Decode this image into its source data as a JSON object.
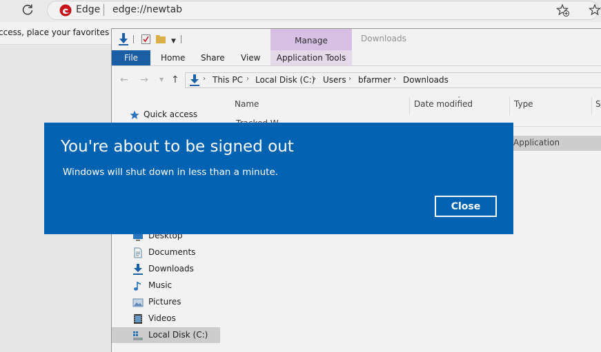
{
  "browser": {
    "site_label": "Edge",
    "url": "edge://newtab",
    "favorites_hint": "ccess, place your favorites here"
  },
  "explorer": {
    "window_title": "Downloads",
    "manage_label": "Manage",
    "ribbon_tabs": [
      "File",
      "Home",
      "Share",
      "View",
      "Application Tools"
    ],
    "breadcrumb": [
      "This PC",
      "Local Disk (C:)",
      "Users",
      "bfarmer",
      "Downloads"
    ],
    "columns": [
      "Name",
      "Date modified",
      "Type",
      "S"
    ],
    "rows": [
      {
        "name": "Tracked W...",
        "type": ""
      },
      {
        "name": "",
        "type": "Application"
      }
    ],
    "quick_access": "Quick access",
    "sidebar": [
      "Desktop",
      "Documents",
      "Downloads",
      "Music",
      "Pictures",
      "Videos",
      "Local Disk (C:)"
    ],
    "selected_sidebar": "Local Disk (C:)"
  },
  "dialog": {
    "title": "You're about to be signed out",
    "message": "Windows will shut down in less than a minute.",
    "close_label": "Close",
    "bg_color": "#0063b1"
  }
}
